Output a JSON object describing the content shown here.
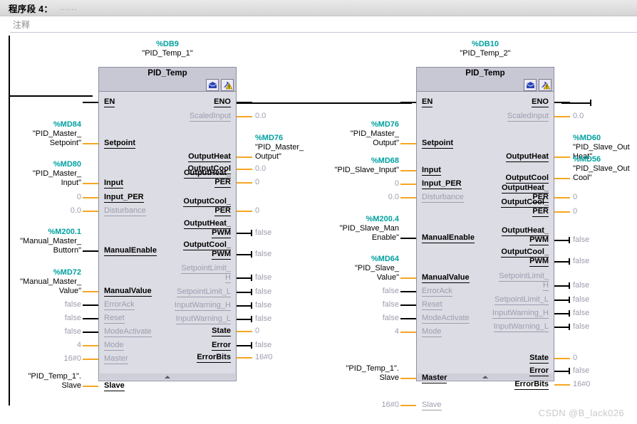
{
  "network": {
    "title": "程序段 4：",
    "title_dots": "......",
    "comment": "注释"
  },
  "watermark": "CSDN @B_lack026",
  "blocks": [
    {
      "db_address": "%DB9",
      "db_symbol": "\"PID_Temp_1\"",
      "block_name": "PID_Temp",
      "icons": [
        "open-folder-icon",
        "config-warning-icon"
      ],
      "inputs": [
        {
          "pin": "EN",
          "enabled": true,
          "wire": "black",
          "operand": null
        },
        {
          "pin": "Setpoint",
          "enabled": true,
          "wire": "orange",
          "operand": {
            "addr": "%MD84",
            "sym": "\"PID_Master_",
            "sym2": "Setpoint\""
          }
        },
        {
          "pin": "Input",
          "enabled": true,
          "wire": "orange",
          "operand": {
            "addr": "%MD80",
            "sym": "\"PID_Master_",
            "sym2": "Input\""
          }
        },
        {
          "pin": "Input_PER",
          "enabled": true,
          "wire": "orange",
          "operand": {
            "val": "0"
          }
        },
        {
          "pin": "Disturbance",
          "enabled": false,
          "wire": "orange",
          "operand": {
            "val": "0.0"
          }
        },
        {
          "pin": "ManualEnable",
          "enabled": true,
          "wire": "black",
          "operand": {
            "addr": "%M200.1",
            "sym": "\"Manual_Master_",
            "sym2": "Buttorn\""
          }
        },
        {
          "pin": "ManualValue",
          "enabled": true,
          "wire": "orange",
          "operand": {
            "addr": "%MD72",
            "sym": "\"Manual_Master_",
            "sym2": "Value\""
          }
        },
        {
          "pin": "ErrorAck",
          "enabled": false,
          "wire": "black",
          "operand": {
            "val": "false"
          }
        },
        {
          "pin": "Reset",
          "enabled": false,
          "wire": "black",
          "operand": {
            "val": "false"
          }
        },
        {
          "pin": "ModeActivate",
          "enabled": false,
          "wire": "black",
          "operand": {
            "val": "false"
          }
        },
        {
          "pin": "Mode",
          "enabled": false,
          "wire": "orange",
          "operand": {
            "val": "4"
          }
        },
        {
          "pin": "Master",
          "enabled": false,
          "wire": "orange",
          "operand": {
            "val": "16#0"
          }
        },
        {
          "pin": "Slave",
          "enabled": true,
          "wire": "orange",
          "operand": {
            "sym": "\"PID_Temp_1\".",
            "sym2": "Slave"
          }
        }
      ],
      "outputs": [
        {
          "pin": "ENO",
          "enabled": true,
          "wire": "black",
          "operand": null
        },
        {
          "pin": "ScaledInput",
          "enabled": false,
          "wire": "orange",
          "operand": {
            "val": "0.0"
          }
        },
        {
          "pin": "OutputHeat",
          "enabled": true,
          "wire": "orange",
          "operand": {
            "addr": "%MD76",
            "sym": "\"PID_Master_",
            "sym2": "Output\""
          }
        },
        {
          "pin": "OutputCool",
          "enabled": true,
          "wire": "orange",
          "operand": {
            "val": "0.0"
          }
        },
        {
          "pin": "OutputHeat_",
          "pin2": "PER",
          "enabled": true,
          "wire": "orange",
          "operand": {
            "val": "0"
          }
        },
        {
          "pin": "OutputCool_",
          "pin2": "PER",
          "enabled": true,
          "wire": "orange",
          "operand": {
            "val": "0"
          }
        },
        {
          "pin": "OutputHeat_",
          "pin2": "PWM",
          "enabled": true,
          "wire": "black",
          "operand": {
            "val": "false"
          }
        },
        {
          "pin": "OutputCool_",
          "pin2": "PWM",
          "enabled": true,
          "wire": "black",
          "operand": {
            "val": "false"
          }
        },
        {
          "pin": "SetpointLimit_",
          "pin2": "H",
          "enabled": false,
          "wire": "black",
          "operand": {
            "val": "false"
          }
        },
        {
          "pin": "SetpointLimit_L",
          "enabled": false,
          "wire": "black",
          "operand": {
            "val": "false"
          }
        },
        {
          "pin": "InputWarning_H",
          "enabled": false,
          "wire": "black",
          "operand": {
            "val": "false"
          }
        },
        {
          "pin": "InputWarning_L",
          "enabled": false,
          "wire": "black",
          "operand": {
            "val": "false"
          }
        },
        {
          "pin": "State",
          "enabled": true,
          "wire": "orange",
          "operand": {
            "val": "0"
          }
        },
        {
          "pin": "Error",
          "enabled": true,
          "wire": "black",
          "operand": {
            "val": "false"
          }
        },
        {
          "pin": "ErrorBits",
          "enabled": true,
          "wire": "orange",
          "operand": {
            "val": "16#0"
          }
        }
      ]
    },
    {
      "db_address": "%DB10",
      "db_symbol": "\"PID_Temp_2\"",
      "block_name": "PID_Temp",
      "icons": [
        "open-folder-icon",
        "config-warning-icon"
      ],
      "inputs": [
        {
          "pin": "EN",
          "enabled": true,
          "wire": "black",
          "operand": null
        },
        {
          "pin": "Setpoint",
          "enabled": true,
          "wire": "orange",
          "operand": {
            "addr": "%MD76",
            "sym": "\"PID_Master_",
            "sym2": "Output\""
          }
        },
        {
          "pin": "Input",
          "enabled": true,
          "wire": "orange",
          "operand": {
            "addr": "%MD68",
            "sym": "\"PID_Slave_Input\""
          }
        },
        {
          "pin": "Input_PER",
          "enabled": true,
          "wire": "orange",
          "operand": {
            "val": "0"
          }
        },
        {
          "pin": "Disturbance",
          "enabled": false,
          "wire": "orange",
          "operand": {
            "val": "0.0"
          }
        },
        {
          "pin": "ManualEnable",
          "enabled": true,
          "wire": "black",
          "operand": {
            "addr": "%M200.4",
            "sym": "\"PID_Slave_Man",
            "sym2": "Enable\""
          }
        },
        {
          "pin": "ManualValue",
          "enabled": true,
          "wire": "orange",
          "operand": {
            "addr": "%MD64",
            "sym": "\"PID_Slave_",
            "sym2": "Value\""
          }
        },
        {
          "pin": "ErrorAck",
          "enabled": false,
          "wire": "black",
          "operand": {
            "val": "false"
          }
        },
        {
          "pin": "Reset",
          "enabled": false,
          "wire": "black",
          "operand": {
            "val": "false"
          }
        },
        {
          "pin": "ModeActivate",
          "enabled": false,
          "wire": "black",
          "operand": {
            "val": "false"
          }
        },
        {
          "pin": "Mode",
          "enabled": false,
          "wire": "orange",
          "operand": {
            "val": "4"
          }
        },
        {
          "pin": "Master",
          "enabled": true,
          "wire": "orange",
          "operand": {
            "sym": "\"PID_Temp_1\".",
            "sym2": "Slave"
          }
        },
        {
          "pin": "Slave",
          "enabled": false,
          "wire": "orange",
          "operand": {
            "val": "16#0"
          }
        }
      ],
      "outputs": [
        {
          "pin": "ENO",
          "enabled": true,
          "wire": "black",
          "operand": null
        },
        {
          "pin": "ScaledInput",
          "enabled": false,
          "wire": "orange",
          "operand": {
            "val": "0.0"
          }
        },
        {
          "pin": "OutputHeat",
          "enabled": true,
          "wire": "orange",
          "operand": {
            "addr": "%MD60",
            "sym": "\"PID_Slave_Out",
            "sym2": "Heat\""
          }
        },
        {
          "pin": "OutputCool",
          "enabled": true,
          "wire": "orange",
          "operand": {
            "addr": "%MD56",
            "sym": "\"PID_Slave_Out",
            "sym2": "Cool\""
          }
        },
        {
          "pin": "OutputHeat_",
          "pin2": "PER",
          "enabled": true,
          "wire": "orange",
          "operand": {
            "val": "0"
          }
        },
        {
          "pin": "OutputCool_",
          "pin2": "PER",
          "enabled": true,
          "wire": "orange",
          "operand": {
            "val": "0"
          }
        },
        {
          "pin": "OutputHeat_",
          "pin2": "PWM",
          "enabled": true,
          "wire": "black",
          "operand": {
            "val": "false"
          }
        },
        {
          "pin": "OutputCool_",
          "pin2": "PWM",
          "enabled": true,
          "wire": "black",
          "operand": {
            "val": "false"
          }
        },
        {
          "pin": "SetpointLimit_",
          "pin2": "H",
          "enabled": false,
          "wire": "black",
          "operand": {
            "val": "false"
          }
        },
        {
          "pin": "SetpointLimit_L",
          "enabled": false,
          "wire": "black",
          "operand": {
            "val": "false"
          }
        },
        {
          "pin": "InputWarning_H",
          "enabled": false,
          "wire": "black",
          "operand": {
            "val": "false"
          }
        },
        {
          "pin": "InputWarning_L",
          "enabled": false,
          "wire": "black",
          "operand": {
            "val": "false"
          }
        },
        {
          "pin": "State",
          "enabled": true,
          "wire": "orange",
          "operand": {
            "val": "0"
          }
        },
        {
          "pin": "Error",
          "enabled": true,
          "wire": "black",
          "operand": {
            "val": "false"
          }
        },
        {
          "pin": "ErrorBits",
          "enabled": true,
          "wire": "orange",
          "operand": {
            "val": "16#0"
          }
        }
      ]
    }
  ],
  "colors": {
    "address": "#00a0a0",
    "wire_value": "#f5a623",
    "wire_bool": "#000000",
    "disabled": "#9d9daf",
    "box_fill": "#dcdce4",
    "box_header": "#c8c8d4"
  }
}
